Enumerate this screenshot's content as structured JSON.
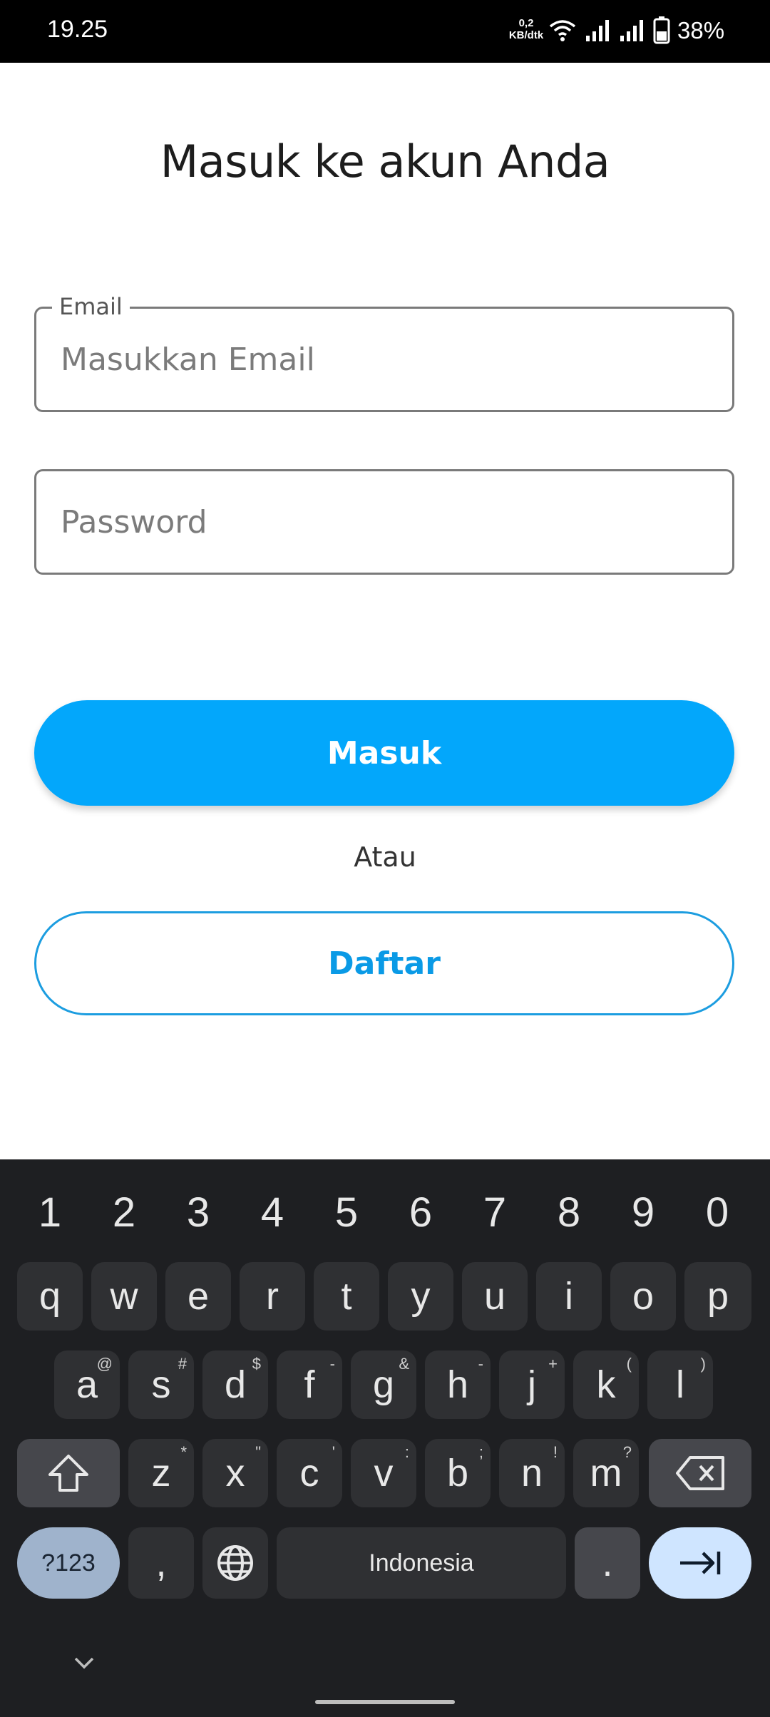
{
  "status_bar": {
    "time": "19.25",
    "net_speed_value": "0,2",
    "net_speed_unit": "KB/dtk",
    "battery_percent": "38%"
  },
  "screen": {
    "title": "Masuk ke akun Anda",
    "email_label": "Email",
    "email_placeholder": "Masukkan Email",
    "password_placeholder": "Password",
    "login_button": "Masuk",
    "or_text": "Atau",
    "register_button": "Daftar"
  },
  "keyboard": {
    "numbers": [
      "1",
      "2",
      "3",
      "4",
      "5",
      "6",
      "7",
      "8",
      "9",
      "0"
    ],
    "row1": [
      "q",
      "w",
      "e",
      "r",
      "t",
      "y",
      "u",
      "i",
      "o",
      "p"
    ],
    "row2": [
      {
        "k": "a",
        "s": "@"
      },
      {
        "k": "s",
        "s": "#"
      },
      {
        "k": "d",
        "s": "$"
      },
      {
        "k": "f",
        "s": "-"
      },
      {
        "k": "g",
        "s": "&"
      },
      {
        "k": "h",
        "s": "-"
      },
      {
        "k": "j",
        "s": "+"
      },
      {
        "k": "k",
        "s": "("
      },
      {
        "k": "l",
        "s": ")"
      }
    ],
    "row3": [
      {
        "k": "z",
        "s": "*"
      },
      {
        "k": "x",
        "s": "\""
      },
      {
        "k": "c",
        "s": "'"
      },
      {
        "k": "v",
        "s": ":"
      },
      {
        "k": "b",
        "s": ";"
      },
      {
        "k": "n",
        "s": "!"
      },
      {
        "k": "m",
        "s": "?"
      }
    ],
    "symbols_key": "?123",
    "comma_key": ",",
    "space_label": "Indonesia",
    "period_key": "."
  },
  "colors": {
    "primary": "#03a7fb",
    "keyboard_bg": "#1e1f22"
  }
}
